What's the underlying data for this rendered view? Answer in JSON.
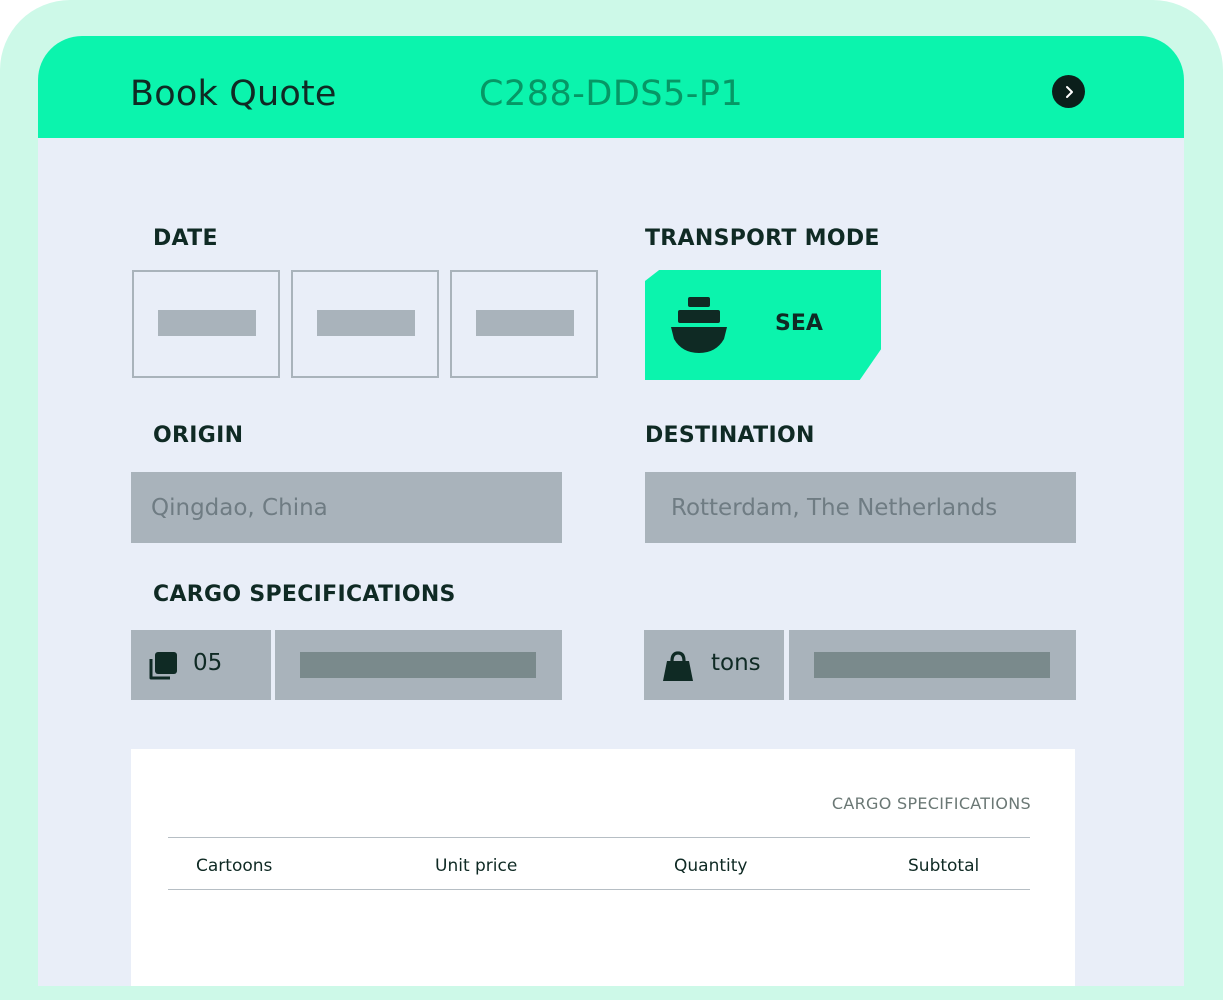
{
  "header": {
    "title": "Book Quote",
    "quote_id": "C288-DDS5-P1",
    "next_icon": "chevron-right-icon"
  },
  "date": {
    "label": "DATE",
    "fields": [
      "day",
      "month",
      "year"
    ]
  },
  "transport": {
    "label": "TRANSPORT MODE",
    "selected": "SEA",
    "icon": "ship-icon"
  },
  "origin": {
    "label": "ORIGIN",
    "value": "Qingdao, China"
  },
  "destination": {
    "label": "DESTINATION",
    "value": "Rotterdam, The Netherlands"
  },
  "cargo": {
    "label": "CARGO SPECIFICATIONS",
    "count": "05",
    "count_icon": "stack-icon",
    "weight_unit": "tons",
    "weight_icon": "weight-icon"
  },
  "summary": {
    "title": "CARGO SPECIFICATIONS",
    "columns": [
      "Cartoons",
      "Unit price",
      "Quantity",
      "Subtotal"
    ]
  },
  "colors": {
    "accent": "#0bf4ad",
    "dark": "#0f2a24",
    "quote_id": "#069765",
    "placeholder": "#a9b3bb"
  }
}
